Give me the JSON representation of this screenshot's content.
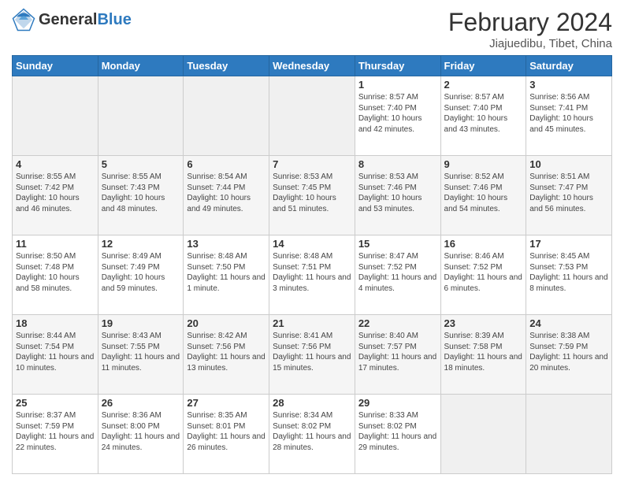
{
  "header": {
    "logo_general": "General",
    "logo_blue": "Blue",
    "title": "February 2024",
    "subtitle": "Jiajuedibu, Tibet, China"
  },
  "days_of_week": [
    "Sunday",
    "Monday",
    "Tuesday",
    "Wednesday",
    "Thursday",
    "Friday",
    "Saturday"
  ],
  "weeks": [
    [
      {
        "day": "",
        "info": "",
        "empty": true
      },
      {
        "day": "",
        "info": "",
        "empty": true
      },
      {
        "day": "",
        "info": "",
        "empty": true
      },
      {
        "day": "",
        "info": "",
        "empty": true
      },
      {
        "day": "1",
        "info": "Sunrise: 8:57 AM\nSunset: 7:40 PM\nDaylight: 10 hours\nand 42 minutes."
      },
      {
        "day": "2",
        "info": "Sunrise: 8:57 AM\nSunset: 7:40 PM\nDaylight: 10 hours\nand 43 minutes."
      },
      {
        "day": "3",
        "info": "Sunrise: 8:56 AM\nSunset: 7:41 PM\nDaylight: 10 hours\nand 45 minutes."
      }
    ],
    [
      {
        "day": "4",
        "info": "Sunrise: 8:55 AM\nSunset: 7:42 PM\nDaylight: 10 hours\nand 46 minutes."
      },
      {
        "day": "5",
        "info": "Sunrise: 8:55 AM\nSunset: 7:43 PM\nDaylight: 10 hours\nand 48 minutes."
      },
      {
        "day": "6",
        "info": "Sunrise: 8:54 AM\nSunset: 7:44 PM\nDaylight: 10 hours\nand 49 minutes."
      },
      {
        "day": "7",
        "info": "Sunrise: 8:53 AM\nSunset: 7:45 PM\nDaylight: 10 hours\nand 51 minutes."
      },
      {
        "day": "8",
        "info": "Sunrise: 8:53 AM\nSunset: 7:46 PM\nDaylight: 10 hours\nand 53 minutes."
      },
      {
        "day": "9",
        "info": "Sunrise: 8:52 AM\nSunset: 7:46 PM\nDaylight: 10 hours\nand 54 minutes."
      },
      {
        "day": "10",
        "info": "Sunrise: 8:51 AM\nSunset: 7:47 PM\nDaylight: 10 hours\nand 56 minutes."
      }
    ],
    [
      {
        "day": "11",
        "info": "Sunrise: 8:50 AM\nSunset: 7:48 PM\nDaylight: 10 hours\nand 58 minutes."
      },
      {
        "day": "12",
        "info": "Sunrise: 8:49 AM\nSunset: 7:49 PM\nDaylight: 10 hours\nand 59 minutes."
      },
      {
        "day": "13",
        "info": "Sunrise: 8:48 AM\nSunset: 7:50 PM\nDaylight: 11 hours\nand 1 minute."
      },
      {
        "day": "14",
        "info": "Sunrise: 8:48 AM\nSunset: 7:51 PM\nDaylight: 11 hours\nand 3 minutes."
      },
      {
        "day": "15",
        "info": "Sunrise: 8:47 AM\nSunset: 7:52 PM\nDaylight: 11 hours\nand 4 minutes."
      },
      {
        "day": "16",
        "info": "Sunrise: 8:46 AM\nSunset: 7:52 PM\nDaylight: 11 hours\nand 6 minutes."
      },
      {
        "day": "17",
        "info": "Sunrise: 8:45 AM\nSunset: 7:53 PM\nDaylight: 11 hours\nand 8 minutes."
      }
    ],
    [
      {
        "day": "18",
        "info": "Sunrise: 8:44 AM\nSunset: 7:54 PM\nDaylight: 11 hours\nand 10 minutes."
      },
      {
        "day": "19",
        "info": "Sunrise: 8:43 AM\nSunset: 7:55 PM\nDaylight: 11 hours\nand 11 minutes."
      },
      {
        "day": "20",
        "info": "Sunrise: 8:42 AM\nSunset: 7:56 PM\nDaylight: 11 hours\nand 13 minutes."
      },
      {
        "day": "21",
        "info": "Sunrise: 8:41 AM\nSunset: 7:56 PM\nDaylight: 11 hours\nand 15 minutes."
      },
      {
        "day": "22",
        "info": "Sunrise: 8:40 AM\nSunset: 7:57 PM\nDaylight: 11 hours\nand 17 minutes."
      },
      {
        "day": "23",
        "info": "Sunrise: 8:39 AM\nSunset: 7:58 PM\nDaylight: 11 hours\nand 18 minutes."
      },
      {
        "day": "24",
        "info": "Sunrise: 8:38 AM\nSunset: 7:59 PM\nDaylight: 11 hours\nand 20 minutes."
      }
    ],
    [
      {
        "day": "25",
        "info": "Sunrise: 8:37 AM\nSunset: 7:59 PM\nDaylight: 11 hours\nand 22 minutes."
      },
      {
        "day": "26",
        "info": "Sunrise: 8:36 AM\nSunset: 8:00 PM\nDaylight: 11 hours\nand 24 minutes."
      },
      {
        "day": "27",
        "info": "Sunrise: 8:35 AM\nSunset: 8:01 PM\nDaylight: 11 hours\nand 26 minutes."
      },
      {
        "day": "28",
        "info": "Sunrise: 8:34 AM\nSunset: 8:02 PM\nDaylight: 11 hours\nand 28 minutes."
      },
      {
        "day": "29",
        "info": "Sunrise: 8:33 AM\nSunset: 8:02 PM\nDaylight: 11 hours\nand 29 minutes."
      },
      {
        "day": "",
        "info": "",
        "empty": true
      },
      {
        "day": "",
        "info": "",
        "empty": true
      }
    ]
  ]
}
